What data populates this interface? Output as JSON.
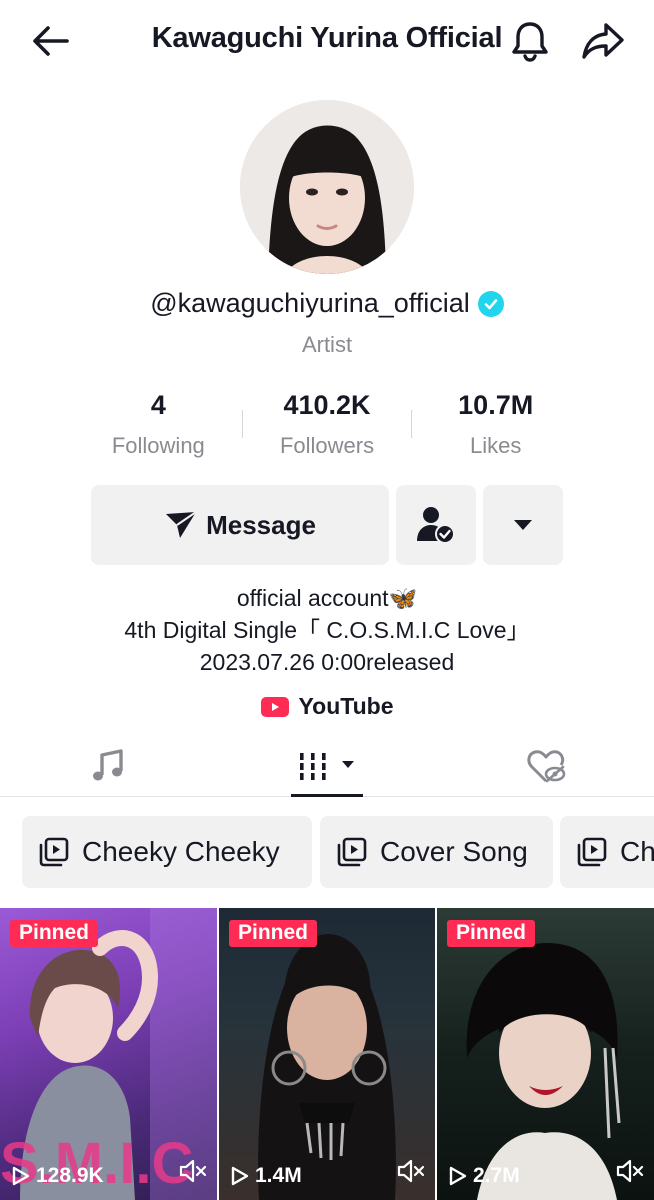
{
  "header": {
    "title": "Kawaguchi Yurina Official",
    "back_icon": "arrow-left-icon",
    "bell_icon": "bell-icon",
    "share_icon": "share-arrow-icon"
  },
  "profile": {
    "username": "@kawaguchiyurina_official",
    "verified": true,
    "category": "Artist",
    "stats": [
      {
        "value": "4",
        "label": "Following"
      },
      {
        "value": "410.2K",
        "label": "Followers"
      },
      {
        "value": "10.7M",
        "label": "Likes"
      }
    ]
  },
  "actions": {
    "message_label": "Message",
    "message_icon": "paper-plane-icon",
    "friend_icon": "user-check-icon",
    "more_icon": "caret-down-icon"
  },
  "bio": {
    "line1": "official account🦋",
    "line2": "4th Digital Single「 C.O.S.M.I.C Love」",
    "line3": "2023.07.26 0:00released"
  },
  "link": {
    "label": "YouTube",
    "icon": "youtube-icon"
  },
  "tabs": [
    {
      "icon": "music-note-icon"
    },
    {
      "icon": "videos-grid-icon",
      "active": true
    },
    {
      "icon": "liked-hidden-heart-icon"
    }
  ],
  "playlists": [
    {
      "label": "Cheeky Cheeky"
    },
    {
      "label": "Cover Song"
    },
    {
      "label": "Ch"
    }
  ],
  "videos": [
    {
      "badge": "Pinned",
      "views": "128.9K"
    },
    {
      "badge": "Pinned",
      "views": "1.4M"
    },
    {
      "badge": "Pinned",
      "views": "2.7M"
    }
  ],
  "colors": {
    "accent": "#fe2c55",
    "verified": "#20d5ec",
    "muted_text": "#8a8b91",
    "button_bg": "#f1f1f2"
  }
}
